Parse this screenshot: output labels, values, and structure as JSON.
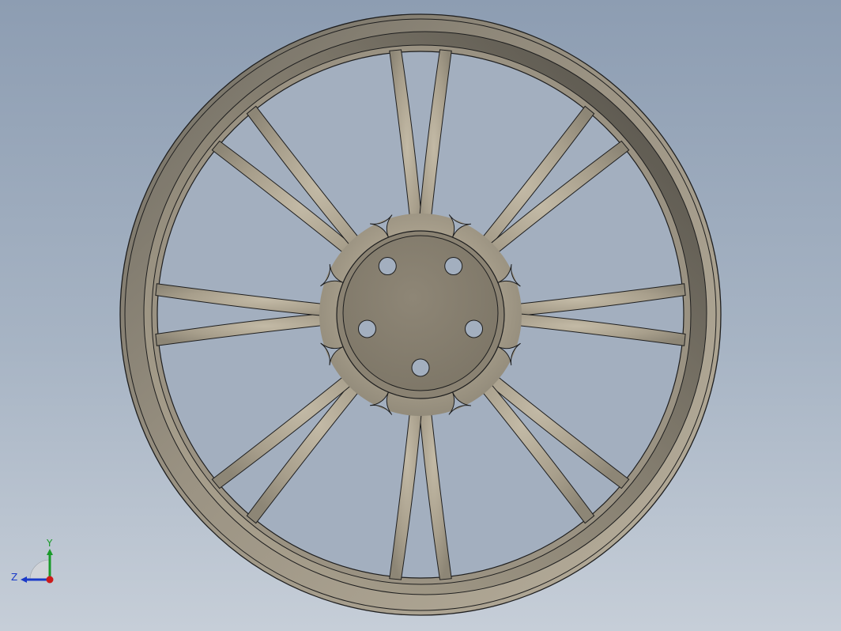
{
  "scene": {
    "model": {
      "name": "wheel",
      "spoke_count": 16,
      "lug_hole_count": 5,
      "body_color": "#a59c8c",
      "edge_color": "#1e1e1e"
    },
    "background": {
      "top_color": "#8d9db2",
      "bottom_color": "#c6ced8"
    }
  },
  "triad": {
    "x_axis_color": "#cc1a1a",
    "y_axis_color": "#1a9a2a",
    "z_axis_color": "#1a3ac8",
    "y_label": "Y",
    "z_label": "Z"
  }
}
